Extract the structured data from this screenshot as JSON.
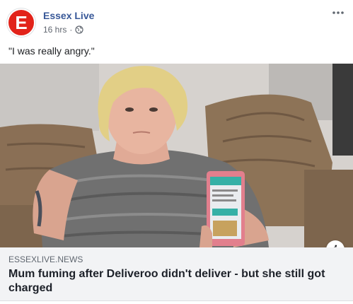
{
  "post": {
    "page_name": "Essex Live",
    "timestamp": "16 hrs",
    "separator": "·",
    "privacy_icon": "globe-icon",
    "more_icon": "ellipsis-icon",
    "text": "\"I was really angry.\"",
    "avatar_letter": "E"
  },
  "link_preview": {
    "domain": "ESSEXLIVE.NEWS",
    "title": "Mum fuming after Deliveroo didn't deliver - but she still got charged",
    "info_label": "i"
  },
  "colors": {
    "brand_red": "#e2231a",
    "link_blue": "#385898",
    "preview_bg": "#f2f3f5"
  }
}
